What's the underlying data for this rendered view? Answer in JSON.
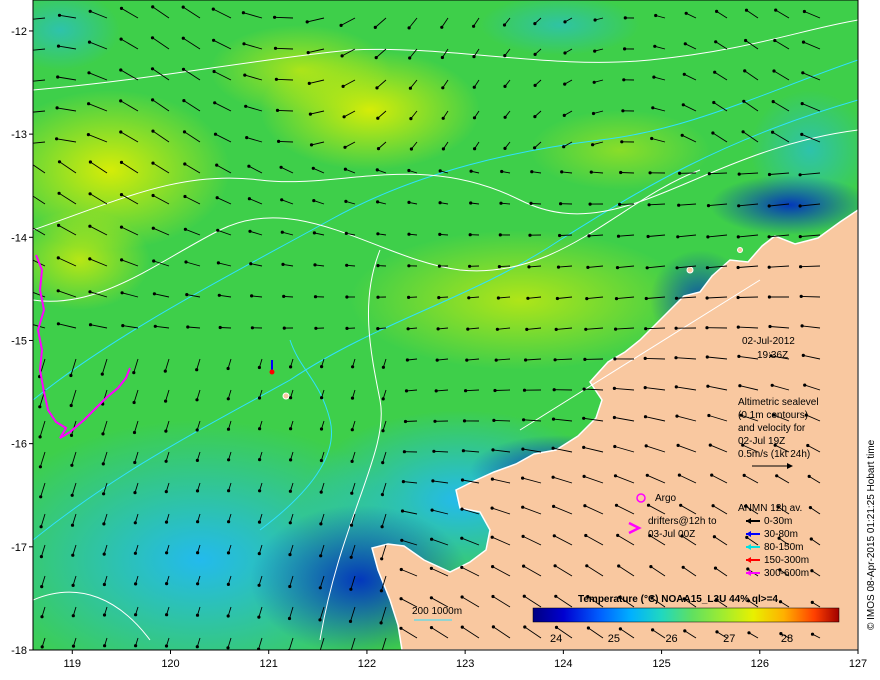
{
  "map": {
    "lon_range": [
      118.6,
      127
    ],
    "lat_range": [
      -18,
      -11.7
    ],
    "x_ticks": [
      "119",
      "120",
      "121",
      "122",
      "123",
      "124",
      "125",
      "126",
      "127"
    ],
    "y_ticks": [
      "-12",
      "-13",
      "-14",
      "-15",
      "-16",
      "-17",
      "-18"
    ]
  },
  "info": {
    "date": "02-Jul-2012",
    "time": "19:36Z",
    "sealevel_lines": [
      "Altimetric sealevel",
      "(0.1m contours)",
      "and velocity for",
      "02-Jul 19Z",
      "0.5m/s (1kt 24h)"
    ],
    "argo_label": "Argo",
    "drifter_lines": [
      "drifters@12h to",
      "03-Jul 00Z"
    ],
    "anmn_title": "ANMN 12h av.",
    "anmn_items": [
      {
        "label": "0-30m",
        "color": "#000000"
      },
      {
        "label": "30-80m",
        "color": "#0000ff"
      },
      {
        "label": "80-150m",
        "color": "#00e0e0"
      },
      {
        "label": "150-300m",
        "color": "#ff0000"
      },
      {
        "label": "300-600m",
        "color": "#ff00ff"
      }
    ],
    "isobath_label": "200  1000m",
    "credit": "© IMOS 08-Apr-2015 01:21:25 Hobart time"
  },
  "colorbar": {
    "title": "Temperature (°C) NOAA15_L3U 44% ql>=4",
    "ticks": [
      "24",
      "25",
      "26",
      "27",
      "28"
    ],
    "range": [
      23.6,
      28.9
    ]
  },
  "colors": {
    "land": "#f9c8a0",
    "argo": "#ff00ff",
    "drifter": "#ff00ff"
  }
}
